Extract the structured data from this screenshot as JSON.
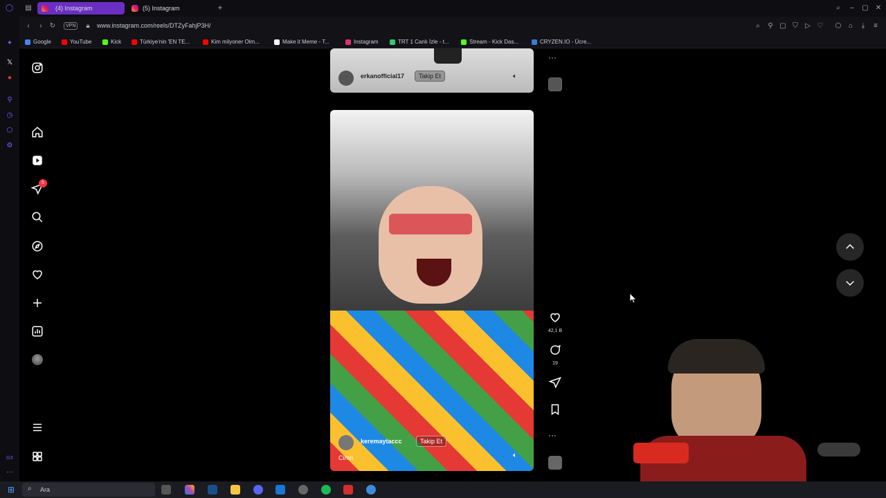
{
  "tabs": [
    {
      "label": "(4) Instagram",
      "active": true
    },
    {
      "label": "(5) Instagram",
      "active": false
    }
  ],
  "address": {
    "url": "www.instagram.com/reels/DTZyFahjP3H/",
    "vpn_label": "VPN"
  },
  "bookmarks": [
    {
      "label": "Google",
      "color": "#4285f4"
    },
    {
      "label": "YouTube",
      "color": "#ff0000"
    },
    {
      "label": "Kick",
      "color": "#53fc18"
    },
    {
      "label": "Türkiye'nin 'EN TE...",
      "color": "#ff0000"
    },
    {
      "label": "Kim milyoner Olm...",
      "color": "#ff0000"
    },
    {
      "label": "Make it Meme - T...",
      "color": "#ffffff"
    },
    {
      "label": "Instagram",
      "color": "#e1306c"
    },
    {
      "label": "TRT 1 Canlı İzle - t...",
      "color": "#2ecc71"
    },
    {
      "label": "Stream - Kick Das...",
      "color": "#53fc18"
    },
    {
      "label": "CRYZEN.IO - Ücre...",
      "color": "#3a7bd5"
    }
  ],
  "sidebar": {
    "notification_count": "5"
  },
  "reels": {
    "top": {
      "username": "erkanofficial17",
      "follow_label": "Takip Et"
    },
    "main": {
      "username": "keremaytaccc",
      "follow_label": "Takip Et",
      "audio_label": "Cimri"
    }
  },
  "actions": {
    "likes": "42,1 B",
    "comments": "19"
  },
  "taskbar": {
    "search_placeholder": "Ara"
  },
  "colors": {
    "accent_tab": "#6a2fc2",
    "badge": "#ff3040"
  }
}
